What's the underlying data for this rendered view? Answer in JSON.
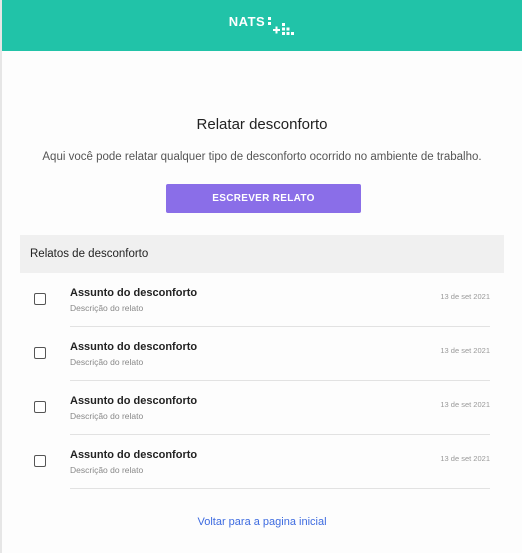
{
  "header": {
    "logo_text": "NATS",
    "accent_color": "#21c3a8"
  },
  "main": {
    "title": "Relatar desconforto",
    "subtitle": "Aqui você pode relatar qualquer tipo de desconforto ocorrido no ambiente de trabalho.",
    "write_button_label": "ESCREVER RELATO",
    "button_color": "#8a6ee8"
  },
  "reports": {
    "header": "Relatos de desconforto",
    "items": [
      {
        "subject": "Assunto do desconforto",
        "description": "Descrição do relato",
        "date": "13 de set 2021",
        "checked": false
      },
      {
        "subject": "Assunto do desconforto",
        "description": "Descrição do relato",
        "date": "13 de set 2021",
        "checked": false
      },
      {
        "subject": "Assunto do desconforto",
        "description": "Descrição do relato",
        "date": "13 de set 2021",
        "checked": false
      },
      {
        "subject": "Assunto do desconforto",
        "description": "Descrição do relato",
        "date": "13 de set 2021",
        "checked": false
      }
    ]
  },
  "footer": {
    "back_link_label": "Voltar para a pagina inicial"
  }
}
